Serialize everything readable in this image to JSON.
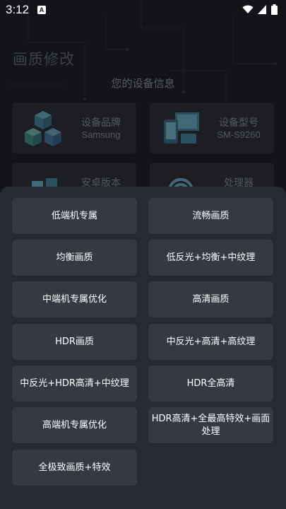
{
  "status_bar": {
    "time": "3:12",
    "notification_badge": "A",
    "icons": [
      "wifi-icon",
      "signal-icon",
      "battery-icon"
    ]
  },
  "page": {
    "title": "画质修改",
    "section_title": "您的设备信息"
  },
  "device_info": [
    {
      "label": "设备品牌",
      "value": "Samsung",
      "icon": "cubes-icon"
    },
    {
      "label": "设备型号",
      "value": "SM-S9260",
      "icon": "devices-icon"
    },
    {
      "label": "安卓版本",
      "value": "",
      "icon": "android-icon"
    },
    {
      "label": "处理器",
      "value": "",
      "icon": "processor-icon"
    }
  ],
  "options": [
    "低端机专属",
    "流畅画质",
    "均衡画质",
    "低反光+均衡+中纹理",
    "中端机专属优化",
    "高清画质",
    "HDR画质",
    "中反光+高清+高纹理",
    "中反光+HDR高清+中纹理",
    "HDR全高清",
    "高端机专属优化",
    "HDR高清+全最高特效+画面处理",
    "全极致画质+特效"
  ],
  "colors": {
    "background": "#131418",
    "sheet": "#272a33",
    "option_button": "#353944",
    "text": "#ffffff"
  }
}
